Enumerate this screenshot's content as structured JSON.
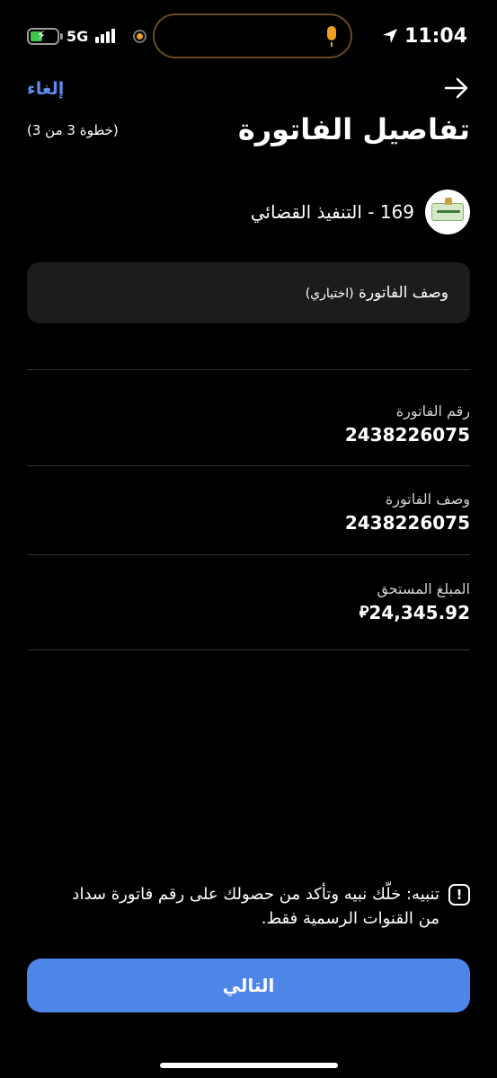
{
  "status_bar": {
    "network": "5G",
    "time": "11:04",
    "battery_level": 0.45,
    "battery_color": "#3ec44a"
  },
  "header": {
    "cancel_label": "إلغاء",
    "title": "تفاصيل الفاتورة",
    "step_text": "(خطوة 3 من 3)",
    "back_icon": "arrow-right-icon"
  },
  "biller": {
    "name": "169 - التنفيذ القضائي",
    "logo_icon": "biller-logo-icon"
  },
  "description_input": {
    "label": "وصف الفاتورة",
    "optional_hint": "(اختياري)",
    "value": ""
  },
  "details": [
    {
      "label": "رقم الفاتورة",
      "value": "2438226075"
    },
    {
      "label": "وصف الفاتورة",
      "value": "2438226075"
    },
    {
      "label": "المبلغ المستحق",
      "value": "24,345.92",
      "currency_symbol": "⃁"
    }
  ],
  "warning": {
    "icon": "exclamation-icon",
    "text": "تنبيه: خلّك نبيه وتأكد من حصولك على رقم فاتورة سداد من القنوات الرسمية فقط."
  },
  "next_button": {
    "label": "التالي",
    "color": "#4e86e8"
  },
  "colors": {
    "accent": "#5b8def",
    "background": "#000000",
    "input_background": "#1c1c1e"
  }
}
